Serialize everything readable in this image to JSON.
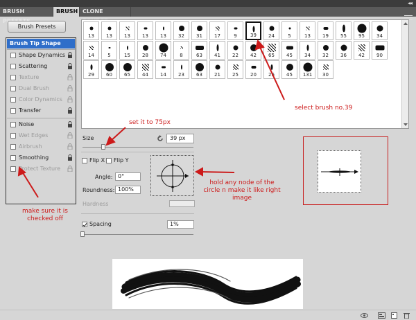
{
  "tabs": [
    {
      "label": "BRUSH PRESETS",
      "active": false
    },
    {
      "label": "BRUSH",
      "active": true
    },
    {
      "label": "CLONE SOURCE",
      "active": false
    }
  ],
  "presets_button": "Brush Presets",
  "sidebar": {
    "items": [
      {
        "label": "Brush Tip Shape",
        "selected": true,
        "enabled": true,
        "checked": false
      },
      {
        "label": "Shape Dynamics",
        "enabled": true,
        "checked": false
      },
      {
        "label": "Scattering",
        "enabled": true,
        "checked": false
      },
      {
        "label": "Texture",
        "enabled": false,
        "checked": false
      },
      {
        "label": "Dual Brush",
        "enabled": false,
        "checked": false
      },
      {
        "label": "Color Dynamics",
        "enabled": false,
        "checked": false
      },
      {
        "label": "Transfer",
        "enabled": true,
        "checked": false
      },
      {
        "label": "Noise",
        "enabled": true,
        "checked": false
      },
      {
        "label": "Wet Edges",
        "enabled": false,
        "checked": false
      },
      {
        "label": "Airbrush",
        "enabled": false,
        "checked": false
      },
      {
        "label": "Smoothing",
        "enabled": true,
        "checked": false
      },
      {
        "label": "Protect Texture",
        "enabled": false,
        "checked": false
      }
    ]
  },
  "brushes": {
    "sizes": [
      "13",
      "13",
      "13",
      "13",
      "13",
      "32",
      "31",
      "17",
      "9",
      "39",
      "24",
      "5",
      "13",
      "19",
      "55",
      "95",
      "34",
      "14",
      "5",
      "15",
      "28",
      "74",
      "8",
      "63",
      "41",
      "22",
      "42",
      "65",
      "45",
      "34",
      "32",
      "36",
      "42",
      "90",
      "29",
      "60",
      "65",
      "44",
      "14",
      "23",
      "63",
      "21",
      "25",
      "20",
      "26",
      "45",
      "131",
      "30"
    ],
    "selected_size": "39"
  },
  "size": {
    "label": "Size",
    "value": "39 px"
  },
  "flip_x": {
    "label": "Flip X",
    "checked": false
  },
  "flip_y": {
    "label": "Flip Y",
    "checked": false
  },
  "angle": {
    "label": "Angle:",
    "value": "0°"
  },
  "roundness": {
    "label": "Roundness:",
    "value": "100%"
  },
  "hardness": {
    "label": "Hardness"
  },
  "spacing": {
    "label": "Spacing",
    "checked": true,
    "value": "1%"
  },
  "annotations": {
    "select_brush": "select brush no.39",
    "set_size": "set it to 75px",
    "hold_node_1": "hold any node of the",
    "hold_node_2": "circle n make it like right",
    "hold_node_3": "image",
    "checked_off_1": "make sure it is",
    "checked_off_2": "checked off"
  },
  "colors": {
    "accent": "#2f6ec9",
    "annotation": "#cc1a1a"
  }
}
